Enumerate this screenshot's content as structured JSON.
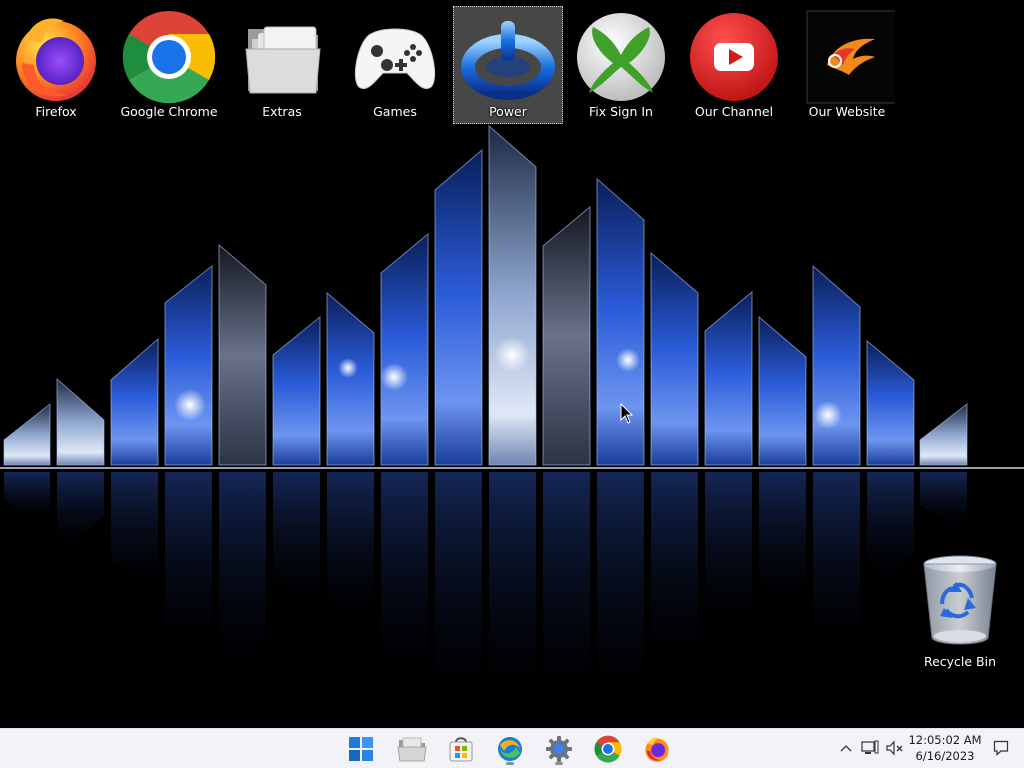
{
  "desktop": {
    "icons": [
      {
        "label": "Firefox",
        "icon": "firefox-icon"
      },
      {
        "label": "Google Chrome",
        "icon": "chrome-icon"
      },
      {
        "label": "Extras",
        "icon": "folder-icon"
      },
      {
        "label": "Games",
        "icon": "gamepad-icon"
      },
      {
        "label": "Power",
        "icon": "power-icon",
        "selected": true
      },
      {
        "label": "Fix Sign In",
        "icon": "xbox-icon"
      },
      {
        "label": "Our Channel",
        "icon": "youtube-icon"
      },
      {
        "label": "Our Website",
        "icon": "eagle-logo-icon"
      }
    ],
    "recycle_bin": {
      "label": "Recycle Bin",
      "icon": "recycle-bin-icon"
    }
  },
  "taskbar": {
    "apps": [
      {
        "name": "start",
        "icon": "windows-start-icon"
      },
      {
        "name": "file-explorer",
        "icon": "file-explorer-icon"
      },
      {
        "name": "microsoft-store",
        "icon": "store-icon"
      },
      {
        "name": "media-player",
        "icon": "media-icon",
        "running": true
      },
      {
        "name": "settings",
        "icon": "settings-gear-icon",
        "running": true
      },
      {
        "name": "chrome",
        "icon": "chrome-icon"
      },
      {
        "name": "firefox",
        "icon": "firefox-icon"
      }
    ],
    "tray": {
      "chevron": "chevron-up-icon",
      "network": "network-icon",
      "volume": "volume-muted-icon",
      "notifications": "notification-icon"
    },
    "clock": {
      "time": "12:05:02 AM",
      "date": "6/16/2023"
    }
  },
  "colors": {
    "taskbar_bg": "#f1f3f7",
    "wallpaper_blue": "#2a5bd8",
    "selection": "rgba(255,255,255,0.28)"
  }
}
